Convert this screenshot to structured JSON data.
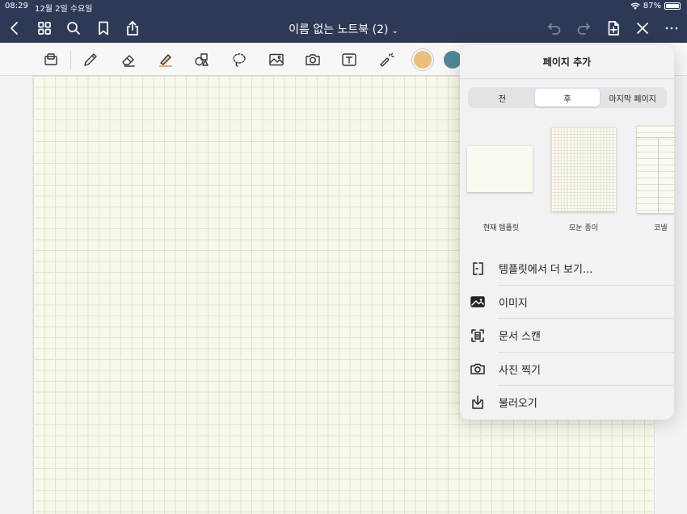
{
  "status": {
    "time": "08:29",
    "date": "12월 2일 수요일",
    "battery": "87%",
    "battery_level": 0.87
  },
  "titlebar": {
    "doc_title": "이름 없는 노트북 (2)",
    "chevron": "⌄"
  },
  "toolbar": {
    "bluetooth_mark": "✱",
    "colors": [
      "#e9bf7c",
      "#4f8a99"
    ]
  },
  "popover": {
    "title": "페이지 추가",
    "segments": [
      "전",
      "후",
      "마지막 페이지"
    ],
    "active_segment": 1,
    "templates": [
      {
        "label": "현재 템플릿"
      },
      {
        "label": "모눈 종이"
      },
      {
        "label": "코넬"
      }
    ],
    "menu": [
      {
        "label": "템플릿에서 더 보기...",
        "icon": "template-icon"
      },
      {
        "label": "이미지",
        "icon": "image-icon"
      },
      {
        "label": "문서 스캔",
        "icon": "scan-icon"
      },
      {
        "label": "사진 찍기",
        "icon": "camera-icon"
      },
      {
        "label": "불러오기",
        "icon": "import-icon"
      }
    ]
  },
  "colors": {
    "nav_bg": "#2e3a55",
    "paper": "#f9f7ea",
    "accent_blue": "#1e7cf2"
  }
}
